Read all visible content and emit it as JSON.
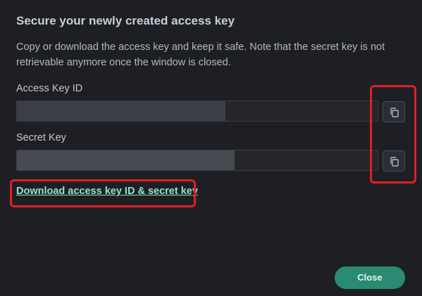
{
  "dialog": {
    "title": "Secure your newly created access key",
    "description": "Copy or download the access key and keep it safe. Note that the secret key is not retrievable anymore once the window is closed."
  },
  "access_key": {
    "label": "Access Key ID",
    "copy_icon": "copy-icon"
  },
  "secret_key": {
    "label": "Secret Key",
    "copy_icon": "copy-icon"
  },
  "download": {
    "label": "Download access key ID & secret key"
  },
  "actions": {
    "close_label": "Close"
  },
  "colors": {
    "background": "#1e1f24",
    "accent": "#2a8a72",
    "link": "#8fe3cf",
    "annotation": "#e01f26"
  }
}
